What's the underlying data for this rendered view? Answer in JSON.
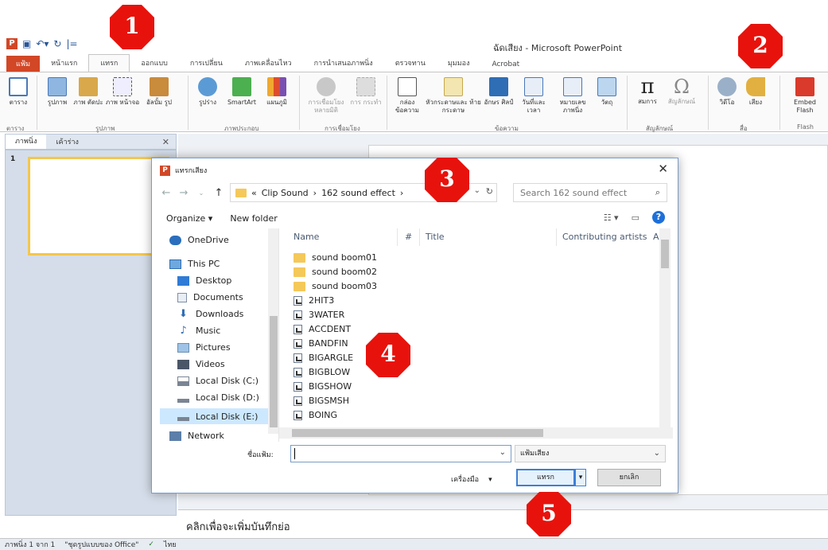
{
  "window": {
    "title": "ฉัดเสียง - Microsoft PowerPoint"
  },
  "ribbon": {
    "tabs": [
      "แฟ้ม",
      "หน้าแรก",
      "แทรก",
      "ออกแบบ",
      "การเปลี่ยน",
      "ภาพเคลื่อนไหว",
      "การนำเสนอภาพนิ่ง",
      "ตรวจทาน",
      "มุมมอง",
      "Acrobat"
    ],
    "buttons": {
      "table": "ตาราง",
      "picture": "รูปภาพ",
      "clipart": "ภาพ ตัดปะ",
      "screenshot": "ภาพ หน้าจอ",
      "photo_album": "อัลบั้ม รูป",
      "shapes": "รูปร่าง",
      "smartart": "SmartArt",
      "chart": "แผนภูมิ",
      "hyperlink": "การเชื่อมโยง หลายมิติ",
      "action": "การ กระทำ",
      "textbox": "กล่อง ข้อความ",
      "header_footer": "หัวกระดาษและ ท้ายกระดาษ",
      "wordart": "อักษร ศิลป์",
      "date_time": "วันที่และ เวลา",
      "slide_number": "หมายเลข ภาพนิ่ง",
      "object": "วัตถุ",
      "equation": "สมการ",
      "symbol": "สัญลักษณ์",
      "video": "วิดีโอ",
      "audio": "เสียง",
      "embed_flash": "Embed Flash"
    },
    "groups": [
      "ตาราง",
      "รูปภาพ",
      "ภาพประกอบ",
      "การเชื่อมโยง",
      "ข้อความ",
      "สัญลักษณ์",
      "สื่อ",
      "Flash"
    ]
  },
  "slide_pane": {
    "tabs": [
      "ภาพนิ่ง",
      "เค้าร่าง"
    ],
    "slide_number": "1"
  },
  "notes": {
    "placeholder": "คลิกเพื่อจะเพิ่มบันทึกย่อ"
  },
  "status": {
    "slide": "ภาพนิ่ง 1 จาก 1",
    "theme": "\"ชุดรูปแบบของ Office\"",
    "language": "ไทย"
  },
  "dialog": {
    "title": "แทรกเสียง",
    "path": [
      "«",
      "Clip Sound",
      "›",
      "162 sound effect",
      "›"
    ],
    "search_placeholder": "Search 162 sound effect",
    "organize": "Organize ▾",
    "new_folder": "New folder",
    "nav_items": [
      "OneDrive",
      "This PC",
      "Desktop",
      "Documents",
      "Downloads",
      "Music",
      "Pictures",
      "Videos",
      "Local Disk (C:)",
      "Local Disk (D:)",
      "Local Disk (E:)",
      "Network"
    ],
    "columns": [
      "Name",
      "#",
      "Title",
      "Contributing artists",
      "A"
    ],
    "folders": [
      "sound boom01",
      "sound boom02",
      "sound boom03"
    ],
    "files": [
      "2HIT3",
      "3WATER",
      "ACCDENT",
      "BANDFIN",
      "BIGARGLE",
      "BIGBLOW",
      "BIGSHOW",
      "BIGSMSH",
      "BOING"
    ],
    "filename_label": "ชื่อแฟ้ม:",
    "filename_value": "",
    "filter": "แฟ้มเสียง",
    "tools": "เครื่องมือ",
    "insert": "แทรก",
    "cancel": "ยกเลิก"
  },
  "markers": [
    "1",
    "2",
    "3",
    "4",
    "5"
  ],
  "colors": {
    "marker": "#e8120c",
    "file_tab": "#d24726",
    "accent": "#3c7fd6"
  }
}
